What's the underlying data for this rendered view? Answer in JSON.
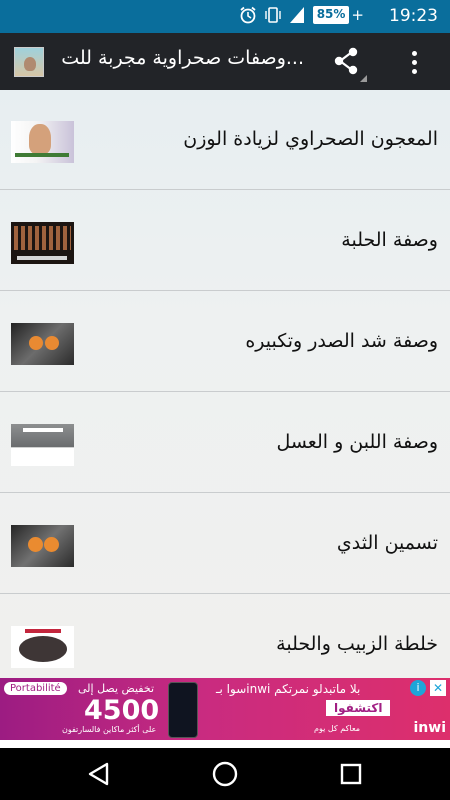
{
  "status_bar": {
    "time": "19:23",
    "battery": "85%"
  },
  "app_bar": {
    "title": "وصفات صحراوية مجربة للت..."
  },
  "list_items": [
    {
      "label": "المعجون الصحراوي لزيادة الوزن"
    },
    {
      "label": "وصفة الحلبة"
    },
    {
      "label": "وصفة شد الصدر وتكبيره"
    },
    {
      "label": "وصفة اللبن و العسل"
    },
    {
      "label": "تسمين الثدي"
    },
    {
      "label": "خلطة الزبيب والحلبة"
    }
  ],
  "ad": {
    "portabilite": "Portabilité",
    "reduction_label": "تخفيض يصل إلى",
    "price": "4500",
    "sub_text": "على أكثر ماكاين فالسارتفون",
    "tagline": "سوا بـinwi بلا ماتبدلو نمرتكم",
    "discover": "اكتشفوا",
    "footer": "معاكم كل يوم",
    "brand": "inwi",
    "colors": {
      "left": "#9c1c82",
      "right": "#dd2f6c"
    }
  },
  "colors": {
    "status_bar": "#0a6e9c",
    "app_bar": "#222428",
    "divider": "#c9ccce"
  },
  "icons": {
    "status": [
      "alarm-icon",
      "vibrate-icon",
      "signal-icon",
      "battery-icon"
    ],
    "app_bar": [
      "app-logo-icon",
      "share-icon",
      "overflow-menu-icon"
    ],
    "nav": [
      "back-icon",
      "home-icon",
      "recents-icon"
    ]
  }
}
